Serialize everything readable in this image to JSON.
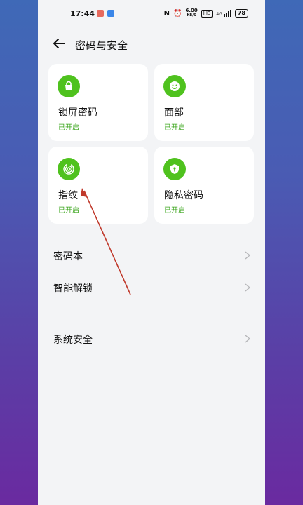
{
  "status_bar": {
    "time": "17:44",
    "network_speed_top": "6.00",
    "network_speed_unit": "KB/S",
    "hd_badge": "HD",
    "signal_label": "4G",
    "battery": "78"
  },
  "header": {
    "title": "密码与安全"
  },
  "cards": [
    {
      "label": "锁屏密码",
      "status": "已开启",
      "icon": "lock-icon"
    },
    {
      "label": "面部",
      "status": "已开启",
      "icon": "face-icon"
    },
    {
      "label": "指纹",
      "status": "已开启",
      "icon": "fingerprint-icon"
    },
    {
      "label": "隐私密码",
      "status": "已开启",
      "icon": "shield-icon"
    }
  ],
  "list": [
    {
      "label": "密码本"
    },
    {
      "label": "智能解锁"
    },
    {
      "label": "系统安全"
    }
  ],
  "colors": {
    "accent_green": "#4fc21e",
    "status_green": "#3aa51b",
    "annotation_red": "#c0392b"
  }
}
